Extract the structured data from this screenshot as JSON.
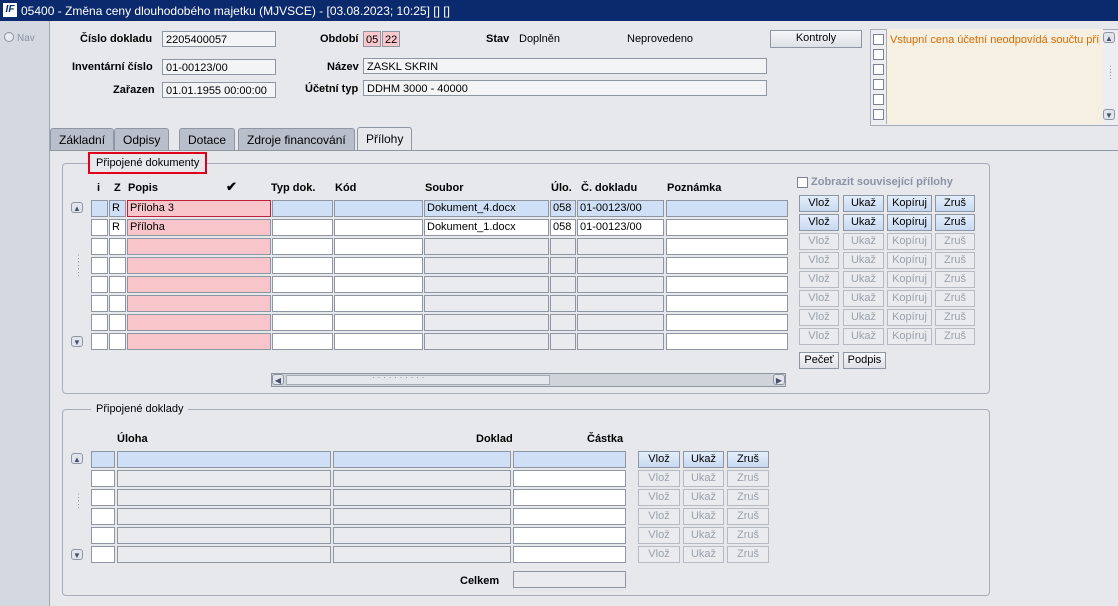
{
  "window": {
    "title": "05400 - Změna ceny dlouhodobého majetku (MJVSCE) - [03.08.2023; 10:25] [] []",
    "app_icon": "IF"
  },
  "nav": {
    "label": "Nav"
  },
  "header": {
    "cislo_dokladu_label": "Číslo dokladu",
    "cislo_dokladu": "2205400057",
    "inventarni_cislo_label": "Inventární číslo",
    "inventarni_cislo": "01-00123/00",
    "zarazen_label": "Zařazen",
    "zarazen": "01.01.1955 00:00:00",
    "obdobi_label": "Období",
    "obdobi_1": "05",
    "obdobi_2": "22",
    "stav_label": "Stav",
    "stav_1": "Doplněn",
    "stav_2": "Neprovedeno",
    "nazev_label": "Název",
    "nazev": "ZASKL SKRIN",
    "ucetni_typ_label": "Účetní typ",
    "ucetni_typ": "DDHM 3000 - 40000",
    "kontroly_label": "Kontroly",
    "warning": "Vstupní cena účetní neodpovídá součtu příp"
  },
  "tabs": [
    {
      "label": "Základní"
    },
    {
      "label": "Odpisy"
    },
    {
      "label": "Dotace"
    },
    {
      "label": "Zdroje financování"
    },
    {
      "label": "Přílohy"
    }
  ],
  "attachments": {
    "group_title": "Připojené dokumenty",
    "show_related_label": "Zobrazit související přílohy",
    "columns": {
      "i": "i",
      "z": "Z",
      "popis": "Popis",
      "check": "✔",
      "typ": "Typ dok.",
      "kod": "Kód",
      "soubor": "Soubor",
      "ulo": "Úlo.",
      "c_dokladu": "Č. dokladu",
      "poznamka": "Poznámka"
    },
    "rows": [
      {
        "z": "R",
        "popis": "Příloha 3",
        "typ": "",
        "kod": "",
        "soubor": "Dokument_4.docx",
        "ulo": "058",
        "c_dokladu": "01-00123/00",
        "poznamka": ""
      },
      {
        "z": "R",
        "popis": "Příloha",
        "typ": "",
        "kod": "",
        "soubor": "Dokument_1.docx",
        "ulo": "058",
        "c_dokladu": "01-00123/00",
        "poznamka": ""
      },
      {
        "z": "",
        "popis": "",
        "typ": "",
        "kod": "",
        "soubor": "",
        "ulo": "",
        "c_dokladu": "",
        "poznamka": ""
      },
      {
        "z": "",
        "popis": "",
        "typ": "",
        "kod": "",
        "soubor": "",
        "ulo": "",
        "c_dokladu": "",
        "poznamka": ""
      },
      {
        "z": "",
        "popis": "",
        "typ": "",
        "kod": "",
        "soubor": "",
        "ulo": "",
        "c_dokladu": "",
        "poznamka": ""
      },
      {
        "z": "",
        "popis": "",
        "typ": "",
        "kod": "",
        "soubor": "",
        "ulo": "",
        "c_dokladu": "",
        "poznamka": ""
      },
      {
        "z": "",
        "popis": "",
        "typ": "",
        "kod": "",
        "soubor": "",
        "ulo": "",
        "c_dokladu": "",
        "poznamka": ""
      },
      {
        "z": "",
        "popis": "",
        "typ": "",
        "kod": "",
        "soubor": "",
        "ulo": "",
        "c_dokladu": "",
        "poznamka": ""
      }
    ],
    "row_buttons": {
      "vloz": "Vlož",
      "ukaz": "Ukaž",
      "kopiruj": "Kopíruj",
      "zrus": "Zruš"
    },
    "pecet_label": "Pečeť",
    "podpis_label": "Podpis"
  },
  "docs": {
    "group_title": "Připojené doklady",
    "columns": {
      "uloha": "Úloha",
      "doklad": "Doklad",
      "castka": "Částka"
    },
    "row_buttons": {
      "vloz": "Vlož",
      "ukaz": "Ukaž",
      "zrus": "Zruš"
    },
    "celkem_label": "Celkem",
    "celkem": ""
  },
  "colors": {
    "titlebar": "#0b2a6e",
    "highlight_box": "#e0001b",
    "warning_text": "#d86a00",
    "selected_row": "#cfe0f6",
    "required_cell": "#f8c6ca"
  }
}
